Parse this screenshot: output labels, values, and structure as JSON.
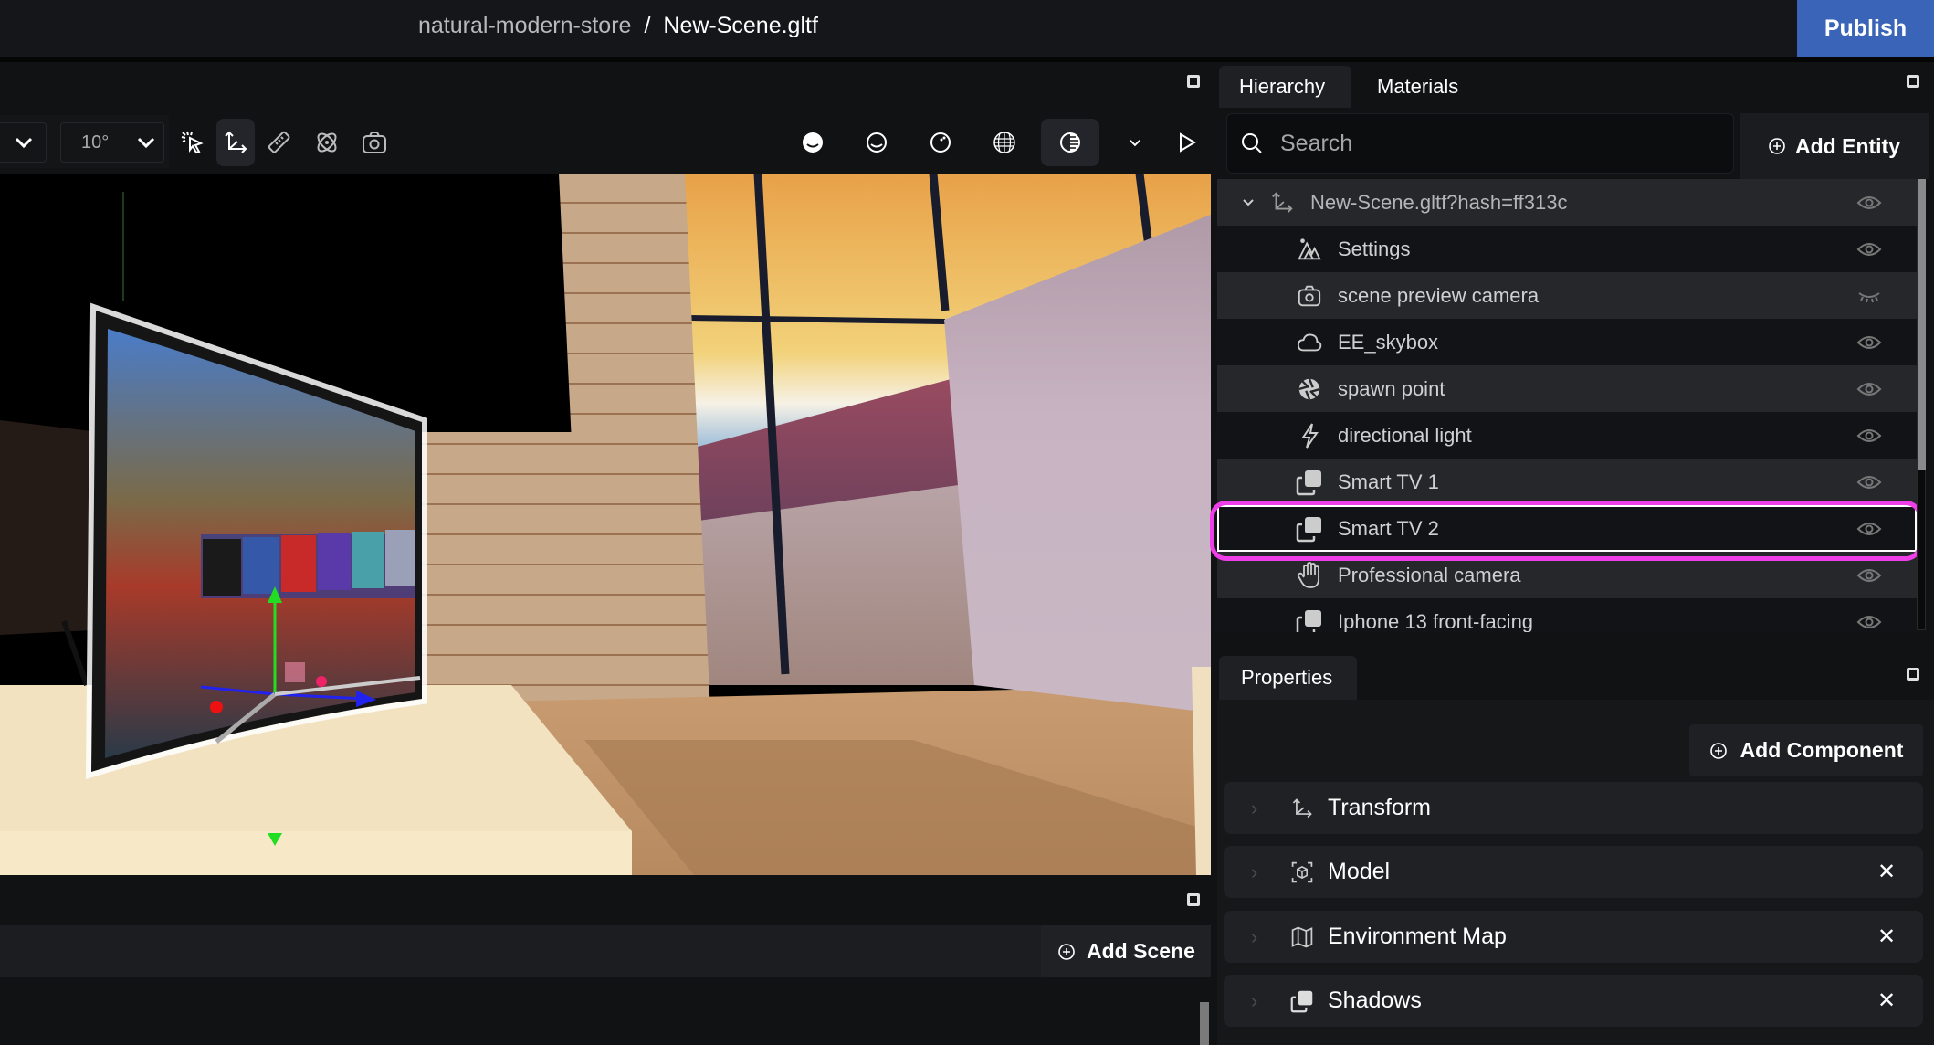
{
  "header": {
    "project_name": "natural-modern-store",
    "separator": "/",
    "file_name": "New-Scene.gltf",
    "publish_label": "Publish"
  },
  "viewport": {
    "toolbar": {
      "first_dropdown_value": "",
      "rotation_snap_value": "10°",
      "tools": [
        {
          "name": "pointer-select",
          "icon": "pointer-click-icon",
          "active": false
        },
        {
          "name": "transform",
          "icon": "transform-axes-icon",
          "active": true
        },
        {
          "name": "measure",
          "icon": "ruler-icon",
          "active": false
        },
        {
          "name": "physics",
          "icon": "atom-icon",
          "active": false
        },
        {
          "name": "screenshot",
          "icon": "camera-icon",
          "active": false
        }
      ],
      "render_modes": [
        {
          "name": "solid",
          "icon": "solid-sphere-icon",
          "active": false
        },
        {
          "name": "outline",
          "icon": "outline-sphere-icon",
          "active": false
        },
        {
          "name": "normals",
          "icon": "dotted-sphere-icon",
          "active": false
        },
        {
          "name": "wireframe",
          "icon": "wireframe-globe-icon",
          "active": false
        },
        {
          "name": "lighting",
          "icon": "half-shaded-sphere-icon",
          "active": true
        }
      ],
      "play_icon": "play-icon"
    },
    "scene_bar": {
      "add_scene_label": "Add Scene"
    }
  },
  "hierarchy": {
    "tabs": [
      {
        "label": "Hierarchy",
        "active": true
      },
      {
        "label": "Materials",
        "active": false
      }
    ],
    "search_placeholder": "Search",
    "add_entity_label": "Add Entity",
    "items": [
      {
        "label": "New-Scene.gltf?hash=ff313c",
        "icon": "transform-axes-icon",
        "visible": true,
        "root": true,
        "expanded": true
      },
      {
        "label": "Settings",
        "icon": "scene-settings-icon",
        "visible": true
      },
      {
        "label": "scene preview camera",
        "icon": "camera-icon",
        "visible": false
      },
      {
        "label": "EE_skybox",
        "icon": "cloud-icon",
        "visible": true
      },
      {
        "label": "spawn point",
        "icon": "aperture-icon",
        "visible": true
      },
      {
        "label": "directional light",
        "icon": "lightning-icon",
        "visible": true
      },
      {
        "label": "Smart TV 1",
        "icon": "shadow-copy-icon",
        "visible": true
      },
      {
        "label": "Smart TV 2",
        "icon": "shadow-copy-icon",
        "visible": true,
        "selected": true
      },
      {
        "label": "Professional camera",
        "icon": "hand-icon",
        "visible": true
      },
      {
        "label": "Iphone 13 front-facing",
        "icon": "shadow-copy-icon",
        "visible": true
      }
    ]
  },
  "properties": {
    "tab_label": "Properties",
    "add_component_label": "Add Component",
    "components": [
      {
        "label": "Transform",
        "icon": "transform-axes-icon",
        "removable": false
      },
      {
        "label": "Model",
        "icon": "model-cube-icon",
        "removable": true
      },
      {
        "label": "Environment Map",
        "icon": "map-icon",
        "removable": true
      },
      {
        "label": "Shadows",
        "icon": "shadow-copy-icon",
        "removable": true
      }
    ]
  },
  "colors": {
    "publish": "#3a64b8",
    "selection_highlight": "#ee3ee8",
    "background": "#111214"
  }
}
